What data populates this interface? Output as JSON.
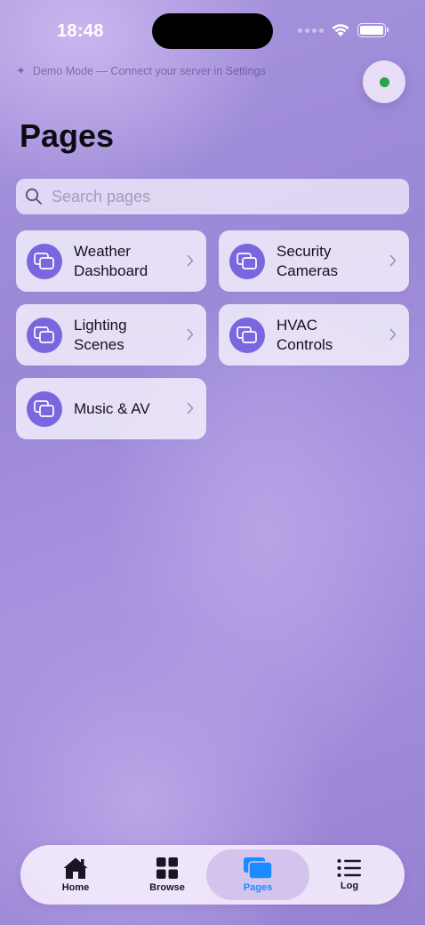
{
  "status_bar": {
    "time": "18:48"
  },
  "demo_banner": {
    "text": "Demo Mode — Connect your server in Settings"
  },
  "connection_status": {
    "color": "#2aa24a"
  },
  "header": {
    "title": "Pages"
  },
  "search": {
    "placeholder": "Search pages",
    "value": ""
  },
  "pages": [
    {
      "label_line1": "Weather",
      "label_line2": "Dashboard",
      "icon": "pages-stack-icon"
    },
    {
      "label_line1": "Security",
      "label_line2": "Cameras",
      "icon": "pages-stack-icon"
    },
    {
      "label_line1": "Lighting",
      "label_line2": "Scenes",
      "icon": "pages-stack-icon"
    },
    {
      "label_line1": "HVAC",
      "label_line2": "Controls",
      "icon": "pages-stack-icon"
    },
    {
      "label_line1": "Music & AV",
      "label_line2": "",
      "icon": "pages-stack-icon"
    }
  ],
  "tab_bar": {
    "tabs": [
      {
        "label": "Home",
        "icon": "house-icon"
      },
      {
        "label": "Browse",
        "icon": "grid-icon"
      },
      {
        "label": "Pages",
        "icon": "pages-stack-icon",
        "active": true
      },
      {
        "label": "Log",
        "icon": "list-icon"
      }
    ]
  },
  "colors": {
    "accent": "#7a67df",
    "active_tab": "#1a8cff"
  }
}
